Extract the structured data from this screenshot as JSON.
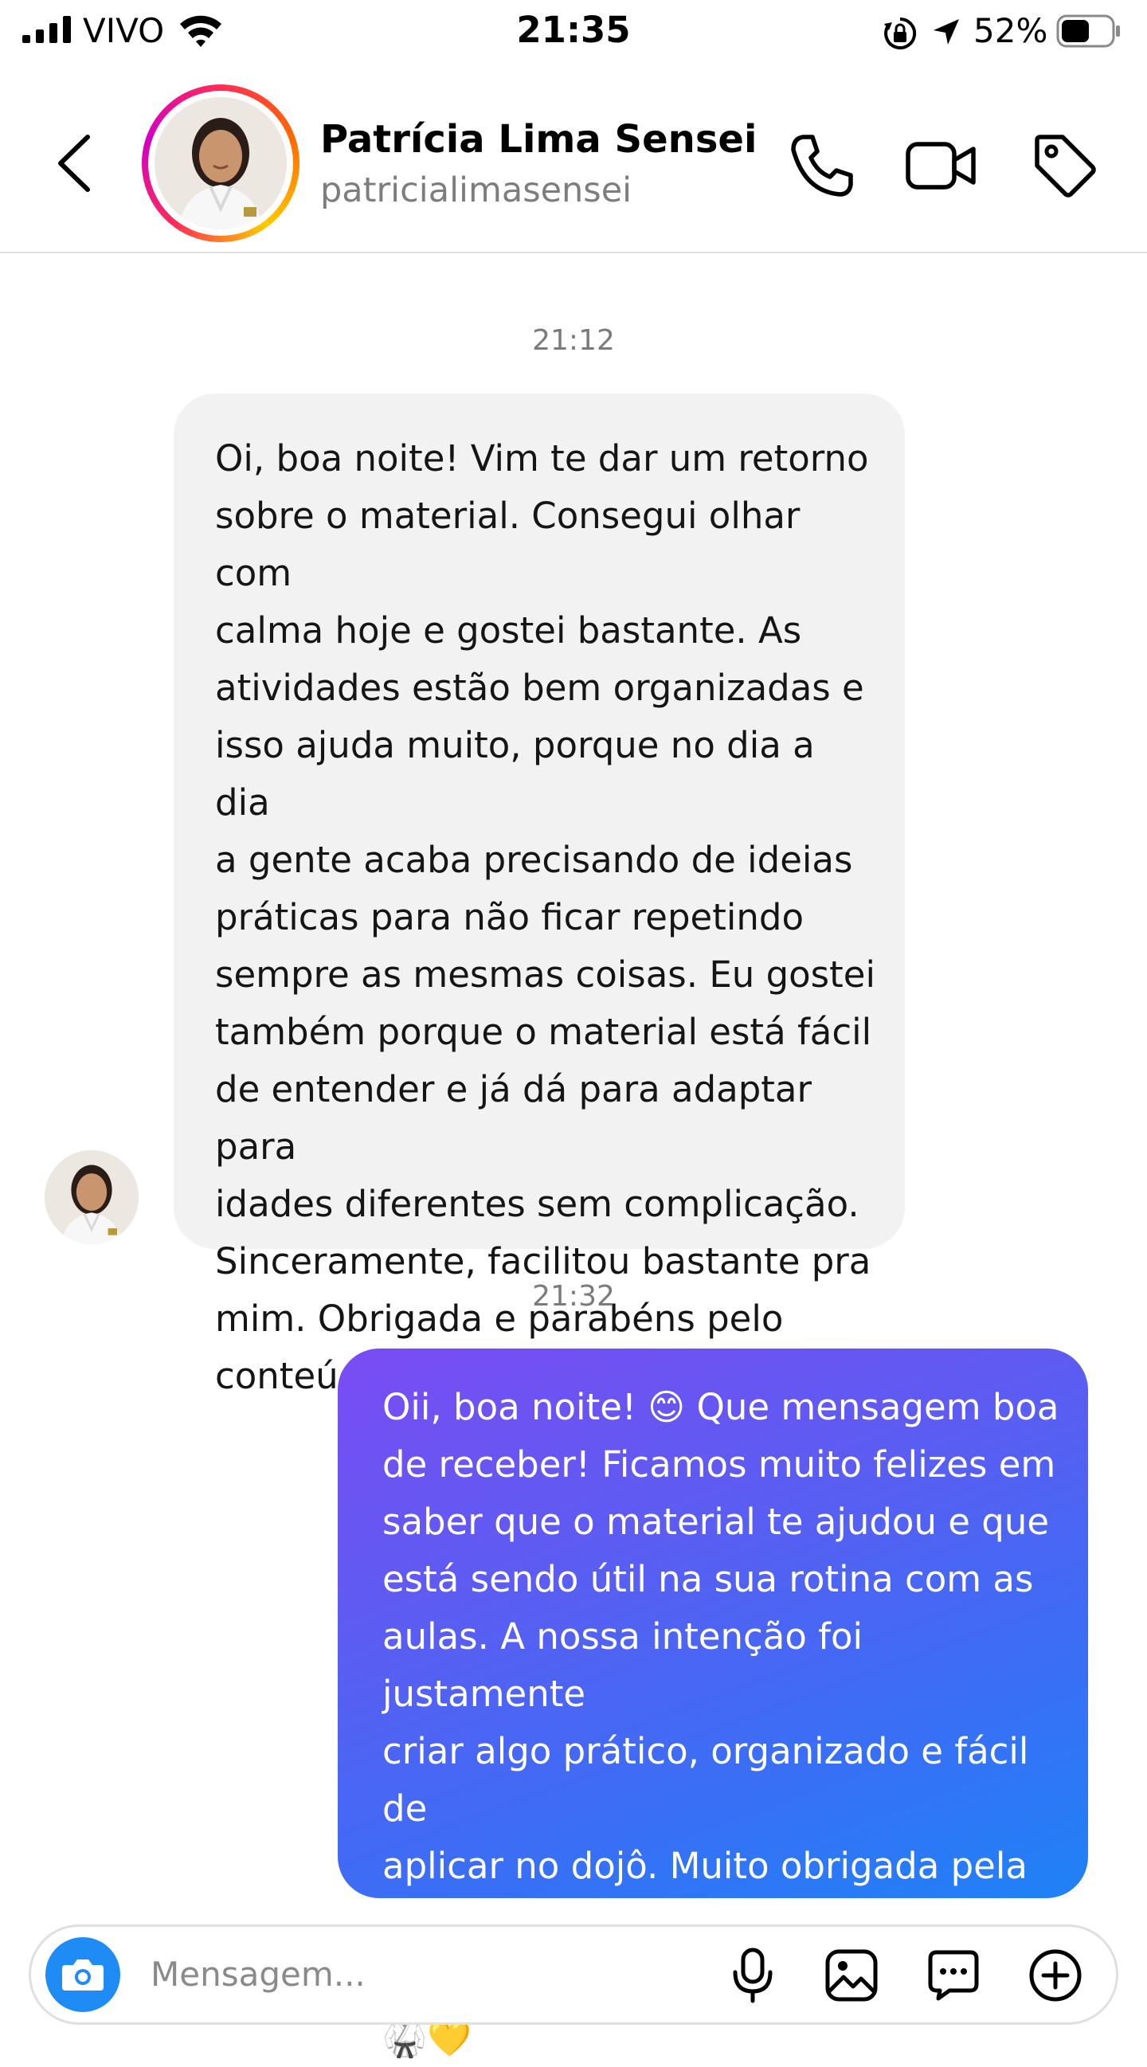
{
  "status_bar": {
    "carrier": "VIVO",
    "time": "21:35",
    "battery": "52%"
  },
  "header": {
    "contact_name": "Patrícia Lima Sensei",
    "username": "patricialimasensei"
  },
  "messages": [
    {
      "timestamp": "21:12",
      "direction": "incoming",
      "text": "Oi, boa noite! Vim te dar um retorno\nsobre o material. Consegui olhar com\ncalma hoje e gostei bastante. As\natividades estão bem organizadas e\nisso ajuda muito, porque no dia a dia\na gente acaba precisando de ideias\npráticas para não ficar repetindo\nsempre as mesmas coisas. Eu gostei\ntambém porque o material está fácil\nde entender e já dá para adaptar para\nidades diferentes sem complicação.\nSinceramente, facilitou bastante pra\nmim. Obrigada e parabéns pelo\nconteúdo!"
    },
    {
      "timestamp": "21:32",
      "direction": "outgoing",
      "text": "Oii, boa noite! 😊 Que mensagem boa\nde receber! Ficamos muito felizes em\nsaber que o material te ajudou e que\nestá sendo útil na sua rotina com as\naulas. A nossa intenção foi justamente\ncriar algo prático, organizado e fácil de\naplicar no dojô. Muito obrigada pela\nconfiança e pelo carinho no feedback!\n🥋💛"
    }
  ],
  "composer": {
    "placeholder": "Mensagem..."
  },
  "colors": {
    "outgoing_gradient_start": "#7a4cf3",
    "outgoing_gradient_end": "#1f82f7",
    "incoming_bubble": "#f2f2f2",
    "camera_button": "#1f8cf5"
  },
  "icons": [
    "signal-icon",
    "wifi-icon",
    "orientation-lock-icon",
    "location-arrow-icon",
    "battery-icon",
    "back-chevron-icon",
    "phone-icon",
    "video-camera-icon",
    "tag-icon",
    "camera-icon",
    "microphone-icon",
    "gallery-icon",
    "sticker-icon",
    "add-icon"
  ]
}
